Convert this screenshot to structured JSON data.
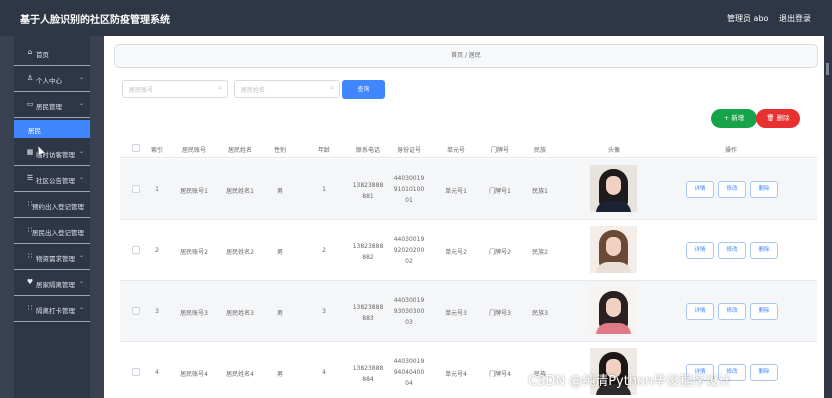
{
  "app": {
    "title": "基于人脸识别的社区防疫管理系统",
    "user": "管理员 abo",
    "logout": "退出登录"
  },
  "sidebar": {
    "items": [
      {
        "label": "首页",
        "icon": "home-icon",
        "chev": ""
      },
      {
        "label": "个人中心",
        "icon": "user-icon",
        "chev": "⌄"
      },
      {
        "label": "居民管理",
        "icon": "residents-icon",
        "chev": "⌄"
      },
      {
        "label": "居民",
        "icon": "",
        "chev": ""
      },
      {
        "label": "临时访客管理",
        "icon": "visitor-icon",
        "chev": "⌄"
      },
      {
        "label": "社区公告管理",
        "icon": "notice-icon",
        "chev": "⌄"
      },
      {
        "label": "预约出入登记管理",
        "icon": "appointment-icon",
        "chev": ""
      },
      {
        "label": "居民出入登记管理",
        "icon": "entry-icon",
        "chev": ""
      },
      {
        "label": "物资需求管理",
        "icon": "supply-icon",
        "chev": "⌄"
      },
      {
        "label": "居家隔离管理",
        "icon": "isolation-icon",
        "chev": "⌄"
      },
      {
        "label": "隔离打卡管理",
        "icon": "checkin-icon",
        "chev": "⌄"
      }
    ]
  },
  "main": {
    "breadcrumb": "首页 / 居民",
    "search": {
      "account_placeholder": "居民账号",
      "name_placeholder": "居民姓名",
      "button": "查询",
      "add": "+ 新增",
      "delete": "🗑 删除"
    },
    "table": {
      "headers": [
        "索引",
        "居民账号",
        "居民姓名",
        "性别",
        "年龄",
        "联系电话",
        "身份证号",
        "单元号",
        "门牌号",
        "民族",
        "头像",
        "操作"
      ],
      "rows": [
        {
          "index": "1",
          "account": "居民账号1",
          "name": "居民姓名1",
          "gender": "男",
          "age": "1",
          "phone1": "13823888",
          "phone2": "881",
          "id1": "44030019",
          "id2": "91010100",
          "id3": "01",
          "unit": "单元号1",
          "door": "门牌号1",
          "ethnic": "民族1"
        },
        {
          "index": "2",
          "account": "居民账号2",
          "name": "居民姓名2",
          "gender": "男",
          "age": "2",
          "phone1": "13823888",
          "phone2": "882",
          "id1": "44030019",
          "id2": "92020200",
          "id3": "02",
          "unit": "单元号2",
          "door": "门牌号2",
          "ethnic": "民族2"
        },
        {
          "index": "3",
          "account": "居民账号3",
          "name": "居民姓名3",
          "gender": "男",
          "age": "3",
          "phone1": "13823888",
          "phone2": "883",
          "id1": "44030019",
          "id2": "93030300",
          "id3": "03",
          "unit": "单元号3",
          "door": "门牌号3",
          "ethnic": "民族3"
        },
        {
          "index": "4",
          "account": "居民账号4",
          "name": "居民姓名4",
          "gender": "男",
          "age": "4",
          "phone1": "13823888",
          "phone2": "884",
          "id1": "44030019",
          "id2": "94040400",
          "id3": "04",
          "unit": "单元号4",
          "door": "门牌号4",
          "ethnic": "民族"
        }
      ],
      "actions": [
        "详情",
        "修改",
        "删除"
      ]
    }
  },
  "watermark": "CSDN @纯清Python毕设程序设计",
  "colors": {
    "primary": "#3f86ff",
    "add": "#16a34a",
    "delete": "#e93030",
    "header": "#2f3646"
  }
}
